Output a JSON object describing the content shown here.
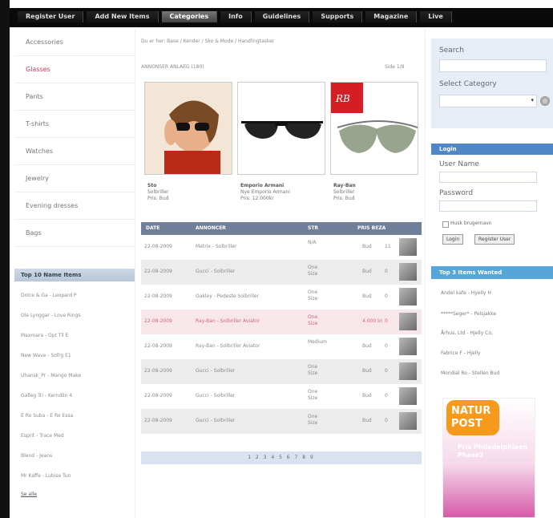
{
  "nav": {
    "items": [
      "Register User",
      "Add New Items",
      "Categories",
      "Info",
      "Guidelines",
      "Supports",
      "Magazine",
      "Live"
    ]
  },
  "categories": [
    "Accessories",
    "Glasses",
    "Pants",
    "T-shirts",
    "Watches",
    "Jewelry",
    "Evening dresses",
    "Bags"
  ],
  "breadcrumb": "Du er her: Base / Kender / Sko & Mode / Handlingtasker",
  "listing": {
    "info": "ANNONSER ANLAEG (180)",
    "page": "Side 1/9"
  },
  "products": [
    {
      "line1": "Sto",
      "line2": "Solbriller",
      "line3": "Pris: Bud"
    },
    {
      "line1": "Emporio Armani",
      "line2": "Nye Emporio Armani",
      "line3": "Pris: 12.000kr"
    },
    {
      "line1": "Ray-Ban",
      "line2": "Solbriller",
      "line3": "Pris: Bud"
    }
  ],
  "table": {
    "headers": [
      "DATE",
      "ANNONCER",
      "STR",
      "PRIS BEZA"
    ],
    "rows": [
      {
        "date": "22-08-2009",
        "name": "Matrix - Solbriller",
        "size": "N/A",
        "price": "Bud",
        "count": "11",
        "style": "normal"
      },
      {
        "date": "22-08-2009",
        "name": "Gucci - Solbriller",
        "size": "One Size",
        "price": "Bud",
        "count": "0",
        "style": "alt"
      },
      {
        "date": "22-08-2009",
        "name": "Oakley - Pedeste Solbriller",
        "size": "One Size",
        "price": "Bud",
        "count": "0",
        "style": "normal"
      },
      {
        "date": "22-08-2009",
        "name": "Ray-Ban - Solbriller Aviator",
        "size": "One Size",
        "price": "4.000 kr.",
        "count": "0",
        "style": "hl"
      },
      {
        "date": "22-08-2009",
        "name": "Ray-Ban - Solbriller Aviator",
        "size": "Medium",
        "price": "Bud",
        "count": "0",
        "style": "normal"
      },
      {
        "date": "22-08-2009",
        "name": "Gucci - Solbriller",
        "size": "One Size",
        "price": "Bud",
        "count": "0",
        "style": "alt"
      },
      {
        "date": "22-08-2009",
        "name": "Gucci - Solbriller",
        "size": "One Size",
        "price": "Bud",
        "count": "0",
        "style": "normal"
      },
      {
        "date": "22-08-2009",
        "name": "Gucci - Solbriller",
        "size": "One Size",
        "price": "Bud",
        "count": "0",
        "style": "alt"
      }
    ]
  },
  "pager": "1 2 3 4 5 6 7 8 9",
  "top_names": {
    "title": "Top 10 Name Items",
    "items": [
      "Dolce & Ga - Leopard P",
      "Ole Lynggar - Love Rings",
      "Maxmara - Opt Til E",
      "New Wave - Sofrg E1",
      "Uhansk_Pr - Mango Make",
      "Galleg Tri - Kerndlin 4",
      "E Ro Suba - E Ro Essa",
      "Esprit - Trace Med",
      "Blend - Jeans",
      "Mr Kaffe - Lubise Tun"
    ],
    "more": "Se alle"
  },
  "search": {
    "title": "Search",
    "category_label": "Select Category"
  },
  "login": {
    "title": "Login",
    "username_label": "User Name",
    "password_label": "Password",
    "remember": "Husk brugernavn",
    "login_btn": "Login",
    "register_btn": "Register User"
  },
  "top3": {
    "title": "Top 3 Items Wanted",
    "items": [
      "Andel kafe - Hyelly H",
      "*****Seger* - Pelsjakke",
      "Århus, Ltd - Hjelly Co,",
      "Fabrice F - Hjelly",
      "Mondial Ro - Stellen Bud"
    ]
  },
  "ad": {
    "logo": "NATUR POST",
    "text": "Pris Philadelphiaen Phase2"
  }
}
